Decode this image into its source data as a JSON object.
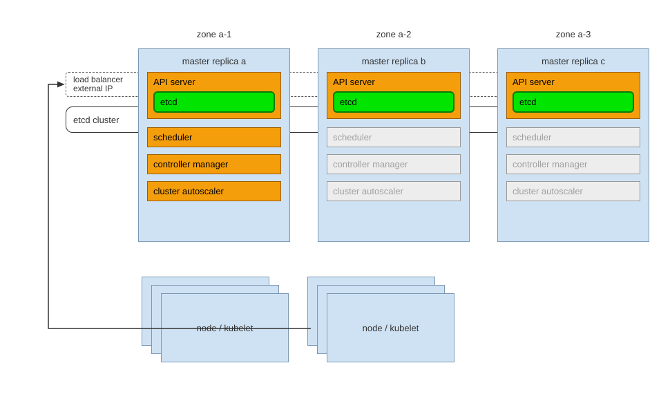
{
  "zones": [
    "zone a-1",
    "zone a-2",
    "zone a-3"
  ],
  "lb_label": "load balancer\nexternal IP",
  "etcd_cluster_label": "etcd cluster",
  "replicas": [
    {
      "title": "master replica a",
      "api": "API server",
      "etcd": "etcd",
      "scheduler": "scheduler",
      "controller": "controller manager",
      "autoscaler": "cluster autoscaler",
      "active": true
    },
    {
      "title": "master replica b",
      "api": "API server",
      "etcd": "etcd",
      "scheduler": "scheduler",
      "controller": "controller manager",
      "autoscaler": "cluster autoscaler",
      "active": false
    },
    {
      "title": "master replica c",
      "api": "API server",
      "etcd": "etcd",
      "scheduler": "scheduler",
      "controller": "controller manager",
      "autoscaler": "cluster autoscaler",
      "active": false
    }
  ],
  "node_label": "node / kubelet",
  "colors": {
    "panel": "#cfe2f3",
    "active": "#f59e0b",
    "inactive": "#ededed",
    "etcd": "#00e400"
  }
}
